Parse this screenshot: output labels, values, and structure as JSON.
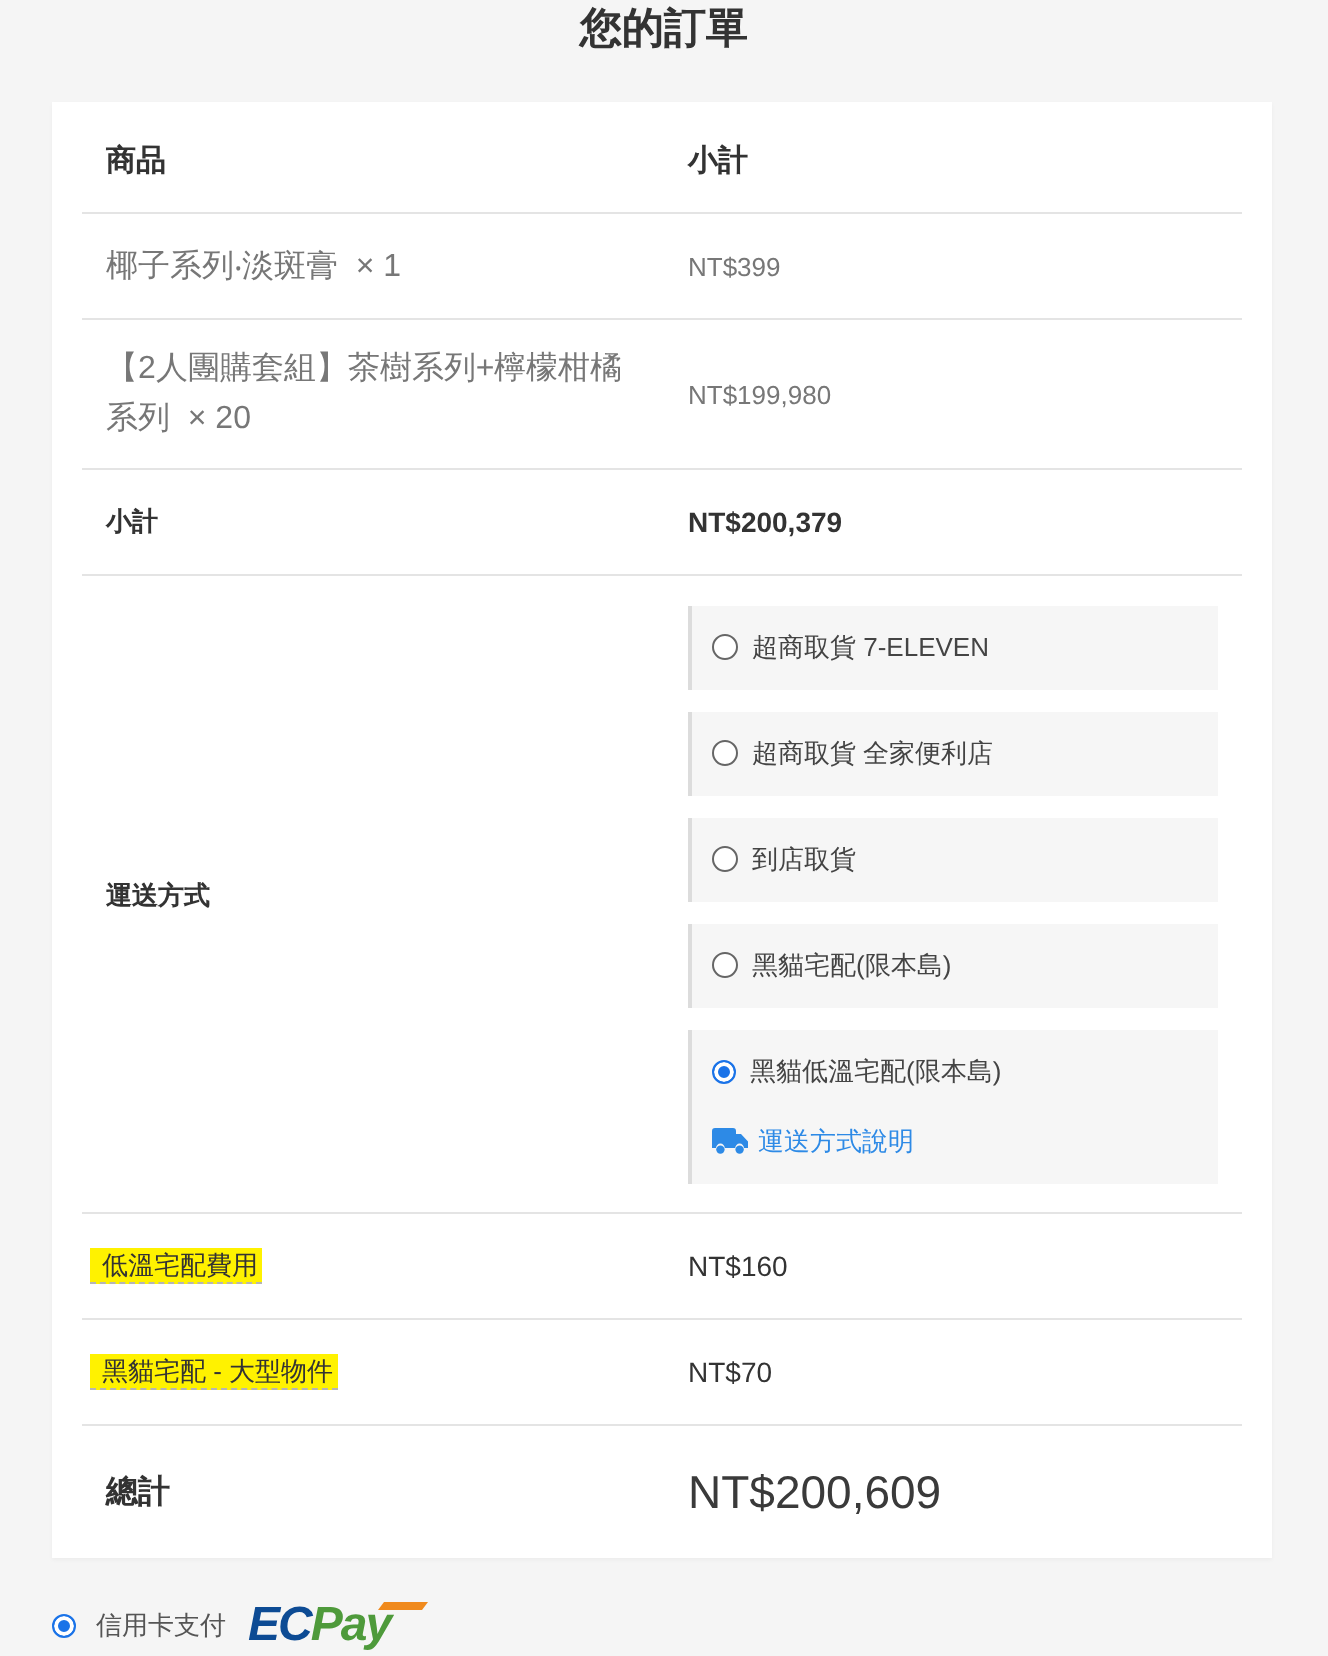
{
  "title": "您的訂單",
  "table": {
    "columns": [
      "商品",
      "小計"
    ],
    "items": [
      {
        "product": "椰子系列‧淡斑膏  × 1",
        "subtotal": "NT$399"
      },
      {
        "product": "【2人團購套組】茶樹系列+檸檬柑橘系列  × 20",
        "subtotal": "NT$199,980"
      }
    ],
    "cart_subtotal": {
      "label": "小計",
      "value": "NT$200,379"
    },
    "shipping": {
      "label": "運送方式",
      "options": [
        {
          "label": "超商取貨 7-ELEVEN",
          "selected": false
        },
        {
          "label": "超商取貨 全家便利店",
          "selected": false
        },
        {
          "label": "到店取貨",
          "selected": false
        },
        {
          "label": "黑貓宅配(限本島)",
          "selected": false
        },
        {
          "label": "黑貓低溫宅配(限本島)",
          "selected": true,
          "info_link": "運送方式說明"
        }
      ]
    },
    "fees": [
      {
        "label": "低溫宅配費用",
        "value": "NT$160",
        "highlighted": true
      },
      {
        "label": "黑貓宅配 - 大型物件",
        "value": "NT$70",
        "highlighted": true
      }
    ],
    "total": {
      "label": "總計",
      "value": "NT$200,609"
    }
  },
  "payment": {
    "methods": [
      {
        "label": "信用卡支付",
        "selected": true,
        "logo": [
          "EC",
          "Pay"
        ]
      }
    ]
  }
}
